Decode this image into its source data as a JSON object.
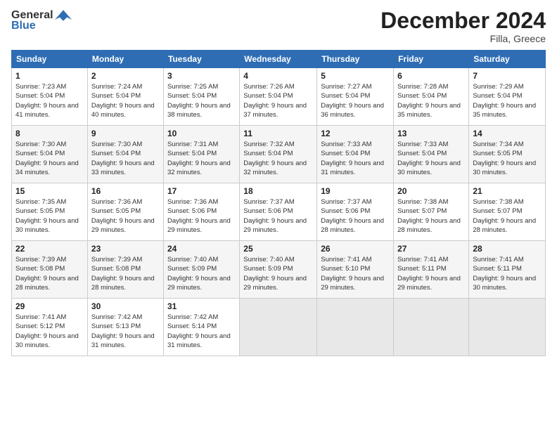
{
  "logo": {
    "general": "General",
    "blue": "Blue"
  },
  "header": {
    "month": "December 2024",
    "location": "Filla, Greece"
  },
  "weekdays": [
    "Sunday",
    "Monday",
    "Tuesday",
    "Wednesday",
    "Thursday",
    "Friday",
    "Saturday"
  ],
  "weeks": [
    [
      {
        "day": "1",
        "sunrise": "7:23 AM",
        "sunset": "5:04 PM",
        "daylight": "9 hours and 41 minutes."
      },
      {
        "day": "2",
        "sunrise": "7:24 AM",
        "sunset": "5:04 PM",
        "daylight": "9 hours and 40 minutes."
      },
      {
        "day": "3",
        "sunrise": "7:25 AM",
        "sunset": "5:04 PM",
        "daylight": "9 hours and 38 minutes."
      },
      {
        "day": "4",
        "sunrise": "7:26 AM",
        "sunset": "5:04 PM",
        "daylight": "9 hours and 37 minutes."
      },
      {
        "day": "5",
        "sunrise": "7:27 AM",
        "sunset": "5:04 PM",
        "daylight": "9 hours and 36 minutes."
      },
      {
        "day": "6",
        "sunrise": "7:28 AM",
        "sunset": "5:04 PM",
        "daylight": "9 hours and 35 minutes."
      },
      {
        "day": "7",
        "sunrise": "7:29 AM",
        "sunset": "5:04 PM",
        "daylight": "9 hours and 35 minutes."
      }
    ],
    [
      {
        "day": "8",
        "sunrise": "7:30 AM",
        "sunset": "5:04 PM",
        "daylight": "9 hours and 34 minutes."
      },
      {
        "day": "9",
        "sunrise": "7:30 AM",
        "sunset": "5:04 PM",
        "daylight": "9 hours and 33 minutes."
      },
      {
        "day": "10",
        "sunrise": "7:31 AM",
        "sunset": "5:04 PM",
        "daylight": "9 hours and 32 minutes."
      },
      {
        "day": "11",
        "sunrise": "7:32 AM",
        "sunset": "5:04 PM",
        "daylight": "9 hours and 32 minutes."
      },
      {
        "day": "12",
        "sunrise": "7:33 AM",
        "sunset": "5:04 PM",
        "daylight": "9 hours and 31 minutes."
      },
      {
        "day": "13",
        "sunrise": "7:33 AM",
        "sunset": "5:04 PM",
        "daylight": "9 hours and 30 minutes."
      },
      {
        "day": "14",
        "sunrise": "7:34 AM",
        "sunset": "5:05 PM",
        "daylight": "9 hours and 30 minutes."
      }
    ],
    [
      {
        "day": "15",
        "sunrise": "7:35 AM",
        "sunset": "5:05 PM",
        "daylight": "9 hours and 30 minutes."
      },
      {
        "day": "16",
        "sunrise": "7:36 AM",
        "sunset": "5:05 PM",
        "daylight": "9 hours and 29 minutes."
      },
      {
        "day": "17",
        "sunrise": "7:36 AM",
        "sunset": "5:06 PM",
        "daylight": "9 hours and 29 minutes."
      },
      {
        "day": "18",
        "sunrise": "7:37 AM",
        "sunset": "5:06 PM",
        "daylight": "9 hours and 29 minutes."
      },
      {
        "day": "19",
        "sunrise": "7:37 AM",
        "sunset": "5:06 PM",
        "daylight": "9 hours and 28 minutes."
      },
      {
        "day": "20",
        "sunrise": "7:38 AM",
        "sunset": "5:07 PM",
        "daylight": "9 hours and 28 minutes."
      },
      {
        "day": "21",
        "sunrise": "7:38 AM",
        "sunset": "5:07 PM",
        "daylight": "9 hours and 28 minutes."
      }
    ],
    [
      {
        "day": "22",
        "sunrise": "7:39 AM",
        "sunset": "5:08 PM",
        "daylight": "9 hours and 28 minutes."
      },
      {
        "day": "23",
        "sunrise": "7:39 AM",
        "sunset": "5:08 PM",
        "daylight": "9 hours and 28 minutes."
      },
      {
        "day": "24",
        "sunrise": "7:40 AM",
        "sunset": "5:09 PM",
        "daylight": "9 hours and 29 minutes."
      },
      {
        "day": "25",
        "sunrise": "7:40 AM",
        "sunset": "5:09 PM",
        "daylight": "9 hours and 29 minutes."
      },
      {
        "day": "26",
        "sunrise": "7:41 AM",
        "sunset": "5:10 PM",
        "daylight": "9 hours and 29 minutes."
      },
      {
        "day": "27",
        "sunrise": "7:41 AM",
        "sunset": "5:11 PM",
        "daylight": "9 hours and 29 minutes."
      },
      {
        "day": "28",
        "sunrise": "7:41 AM",
        "sunset": "5:11 PM",
        "daylight": "9 hours and 30 minutes."
      }
    ],
    [
      {
        "day": "29",
        "sunrise": "7:41 AM",
        "sunset": "5:12 PM",
        "daylight": "9 hours and 30 minutes."
      },
      {
        "day": "30",
        "sunrise": "7:42 AM",
        "sunset": "5:13 PM",
        "daylight": "9 hours and 31 minutes."
      },
      {
        "day": "31",
        "sunrise": "7:42 AM",
        "sunset": "5:14 PM",
        "daylight": "9 hours and 31 minutes."
      },
      null,
      null,
      null,
      null
    ]
  ]
}
